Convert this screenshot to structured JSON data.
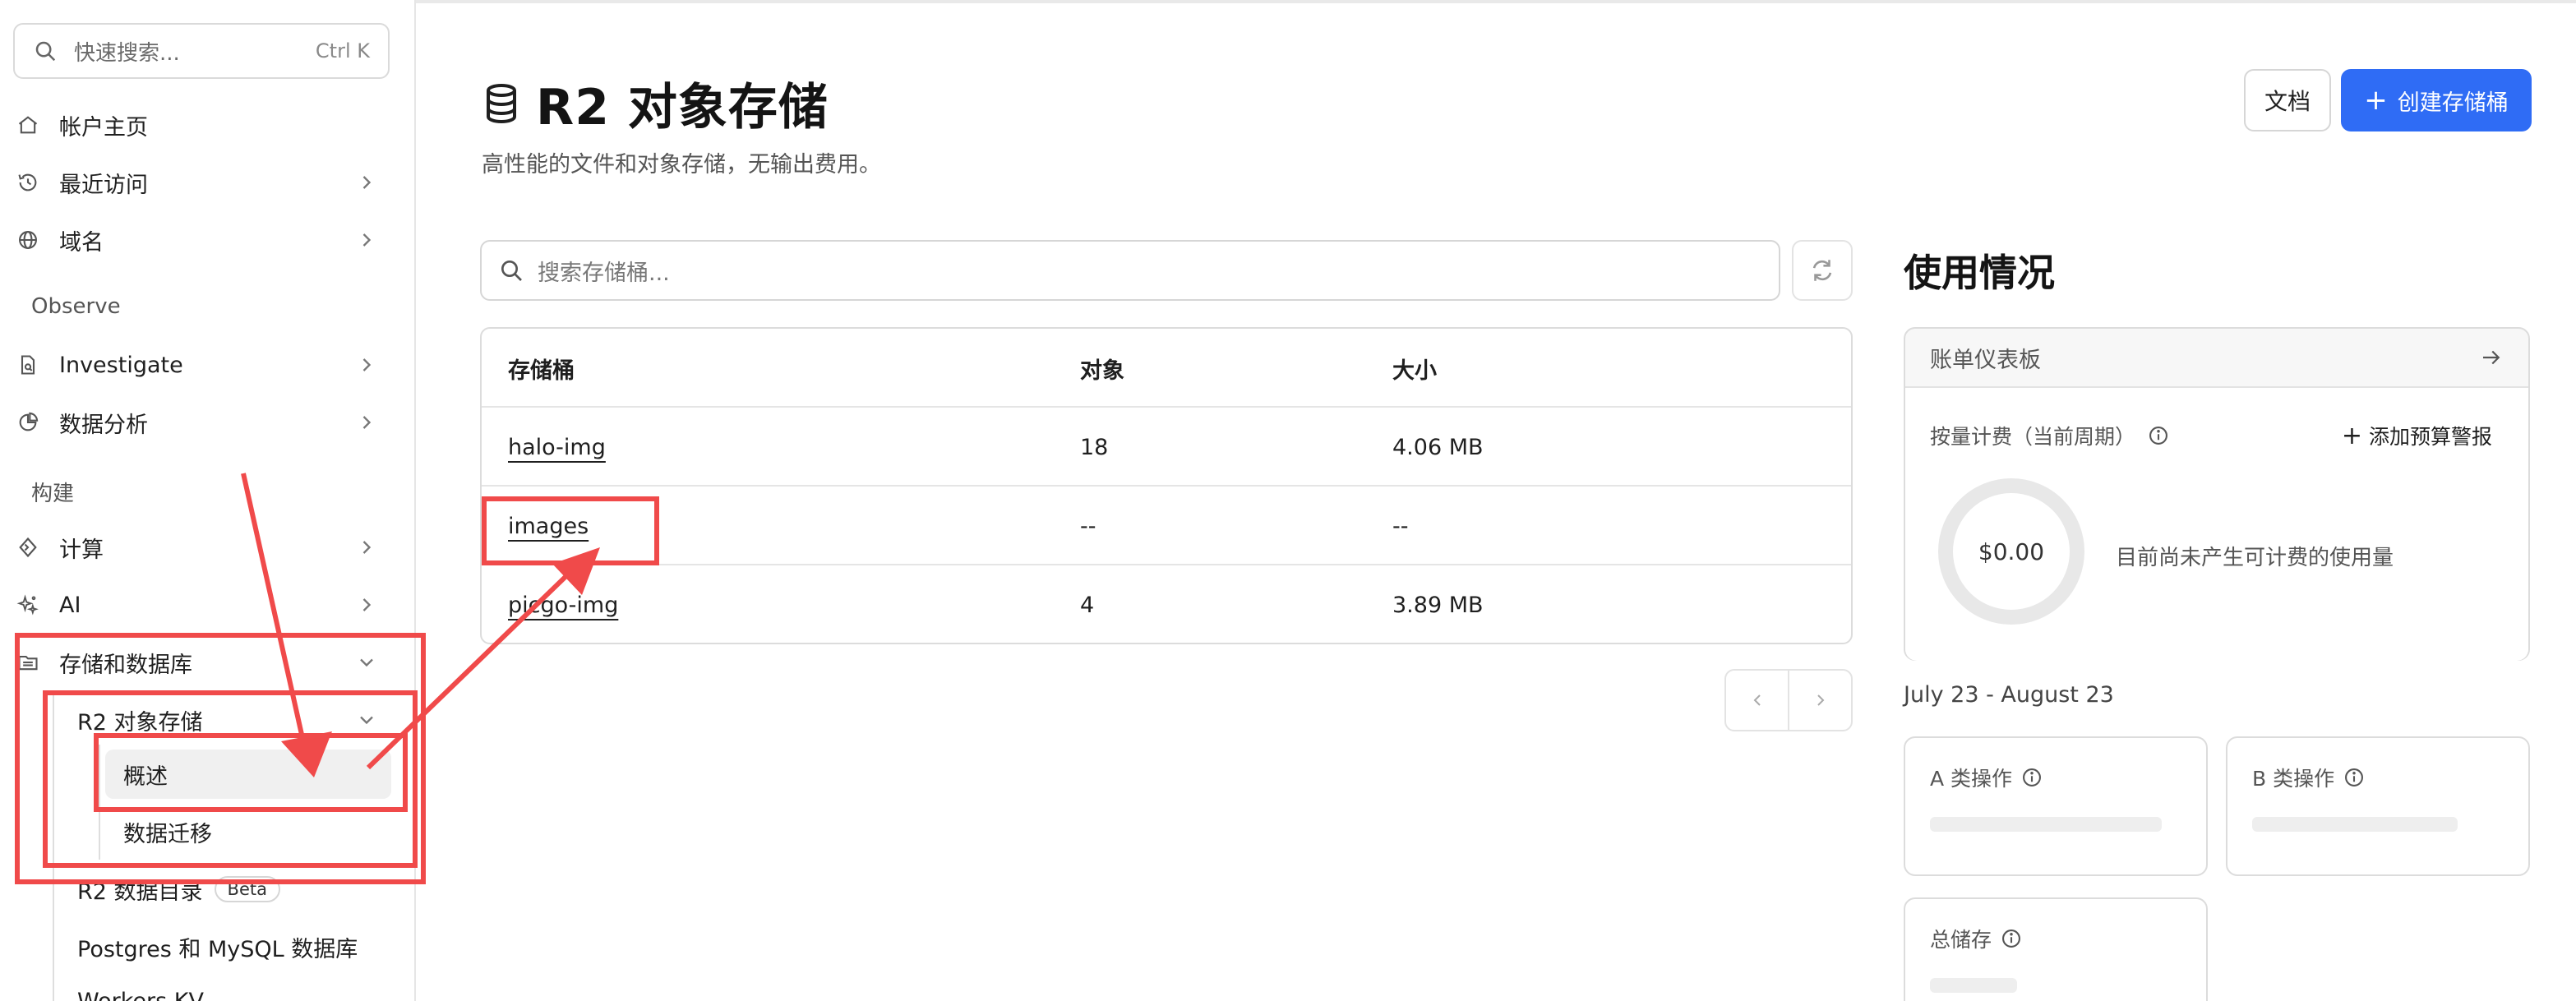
{
  "sidebar": {
    "search_placeholder": "快速搜索...",
    "search_shortcut": "Ctrl K",
    "items": {
      "home": "帐户主页",
      "recent": "最近访问",
      "domains": "域名",
      "investigate": "Investigate",
      "analytics": "数据分析",
      "compute": "计算",
      "ai": "AI",
      "storage": "存储和数据库"
    },
    "sections": {
      "observe": "Observe",
      "build": "构建"
    },
    "storage_children": {
      "r2": "R2 对象存储",
      "overview": "概述",
      "migration": "数据迁移",
      "catalog": "R2 数据目录",
      "catalog_badge": "Beta",
      "postgres": "Postgres 和 MySQL 数据库",
      "kv": "Workers KV"
    }
  },
  "header": {
    "title": "R2 对象存储",
    "subtitle": "高性能的文件和对象存储，无输出费用。",
    "docs_button": "文档",
    "create_button": "创建存储桶"
  },
  "buckets": {
    "search_placeholder": "搜索存储桶...",
    "columns": [
      "存储桶",
      "对象",
      "大小"
    ],
    "rows": [
      {
        "name": "halo-img",
        "objects": "18",
        "size": "4.06 MB"
      },
      {
        "name": "images",
        "objects": "--",
        "size": "--"
      },
      {
        "name": "picgo-img",
        "objects": "4",
        "size": "3.89 MB"
      }
    ]
  },
  "usage": {
    "title": "使用情况",
    "billing_dashboard": "账单仪表板",
    "metered_label": "按量计费（当前周期）",
    "add_alert": "添加预算警报",
    "amount": "$0.00",
    "no_usage_text": "目前尚未产生可计费的使用量",
    "period": "July 23 - August 23",
    "class_a": "A 类操作",
    "class_b": "B 类操作",
    "total_storage": "总储存"
  },
  "colors": {
    "primary": "#2f6cf5",
    "annotation": "#f04a4a",
    "border": "#dcdcdc"
  }
}
